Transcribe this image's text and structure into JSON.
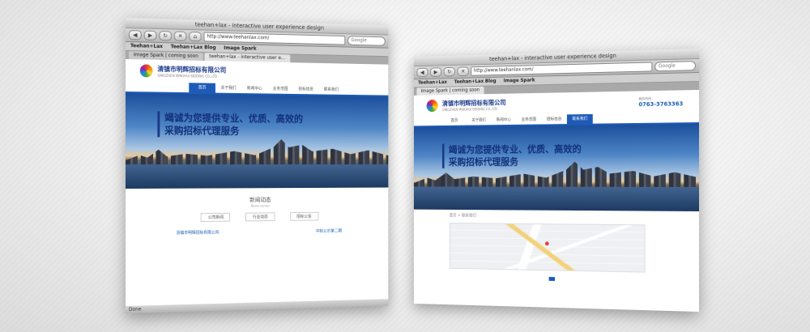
{
  "browser": {
    "title": "teehan+lax - interactive user experience design",
    "url": "http://www.teehanlax.com/",
    "search_placeholder": "Google",
    "bookmarks": [
      "Teehan+Lax",
      "Teehan+Lax Blog",
      "Image Spark"
    ],
    "tabs": [
      "Image Spark | coming soon",
      "teehan+lax - interactive user e..."
    ],
    "front_bookmarks": [
      "Teehan+Lax",
      "Teehan+Lax Blog",
      "Image Spark"
    ],
    "front_tabs": [
      "Image Spark | coming soon"
    ],
    "status": "Done"
  },
  "site": {
    "company_name": "清镇市明辉招标有限公司",
    "company_sub": "QINGZHEN MINGHUI BIDDING CO.,LTD",
    "contact_label": "服务热线",
    "phone": "0763-3763363",
    "nav": [
      "首页",
      "关于我们",
      "新闻中心",
      "业务范围",
      "招标信息",
      "联系我们"
    ],
    "banner_line1": "竭诚为您提供专业、优质、高效的",
    "banner_line2": "采购招标代理服务",
    "news_title": "新闻动态",
    "news_sub": "News center",
    "news_tabs": [
      "公司新闻",
      "行业动态",
      "招标公告"
    ],
    "news_items": [
      "清镇市明辉招标有限公司",
      "中标公示第二期"
    ],
    "breadcrumb": "首页 > 联系我们"
  },
  "colors": {
    "brand_blue": "#1e5bb8",
    "headline_blue": "#11307a"
  }
}
